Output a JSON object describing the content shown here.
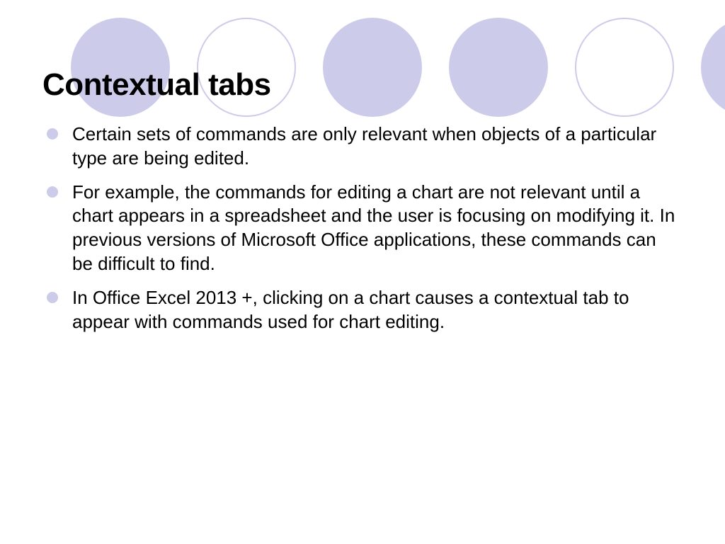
{
  "title": "Contextual tabs",
  "bullets": [
    "Certain sets of commands are only relevant when objects of a particular type are being edited.",
    " For example, the commands for editing a chart are not relevant until a chart appears in a spreadsheet and the user is focusing on modifying it. In previous versions of Microsoft Office applications, these commands can be difficult to find.",
    " In Office Excel 2013 +, clicking on a chart causes a contextual tab to appear with commands used for chart editing."
  ],
  "decorations": {
    "circles": [
      "filled",
      "outline",
      "filled",
      "filled",
      "outline",
      "filled"
    ]
  }
}
